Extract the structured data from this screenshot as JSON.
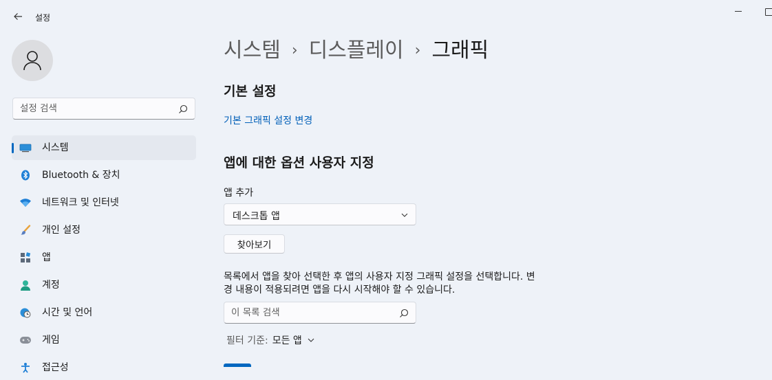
{
  "window": {
    "title": "설정"
  },
  "sidebar": {
    "search_placeholder": "설정 검색",
    "items": [
      {
        "label": "시스템",
        "icon": "system-icon",
        "selected": true
      },
      {
        "label": "Bluetooth & 장치",
        "icon": "bluetooth-icon"
      },
      {
        "label": "네트워크 및 인터넷",
        "icon": "wifi-icon"
      },
      {
        "label": "개인 설정",
        "icon": "brush-icon"
      },
      {
        "label": "앱",
        "icon": "apps-icon"
      },
      {
        "label": "계정",
        "icon": "account-icon"
      },
      {
        "label": "시간 및 언어",
        "icon": "globe-clock-icon"
      },
      {
        "label": "게임",
        "icon": "gamepad-icon"
      },
      {
        "label": "접근성",
        "icon": "accessibility-icon"
      }
    ]
  },
  "breadcrumb": {
    "items": [
      "시스템",
      "디스플레이",
      "그래픽"
    ],
    "separator": "›"
  },
  "main": {
    "basic_heading": "기본 설정",
    "default_link": "기본 그래픽 설정 변경",
    "custom_heading": "앱에 대한 옵션 사용자 지정",
    "add_app_label": "앱 추가",
    "app_type_value": "데스크톱 앱",
    "browse_button": "찾아보기",
    "description": "목록에서 앱을 찾아 선택한 후 앱의 사용자 지정 그래픽 설정을 선택합니다. 변경 내용이 적용되려면 앱을 다시 시작해야 할 수 있습니다.",
    "list_search_placeholder": "이 목록 검색",
    "filter_label": "필터 기준:",
    "filter_value": "모든 앱"
  },
  "colors": {
    "accent": "#0067c0",
    "link": "#005fb8",
    "background": "#eef2f8"
  }
}
